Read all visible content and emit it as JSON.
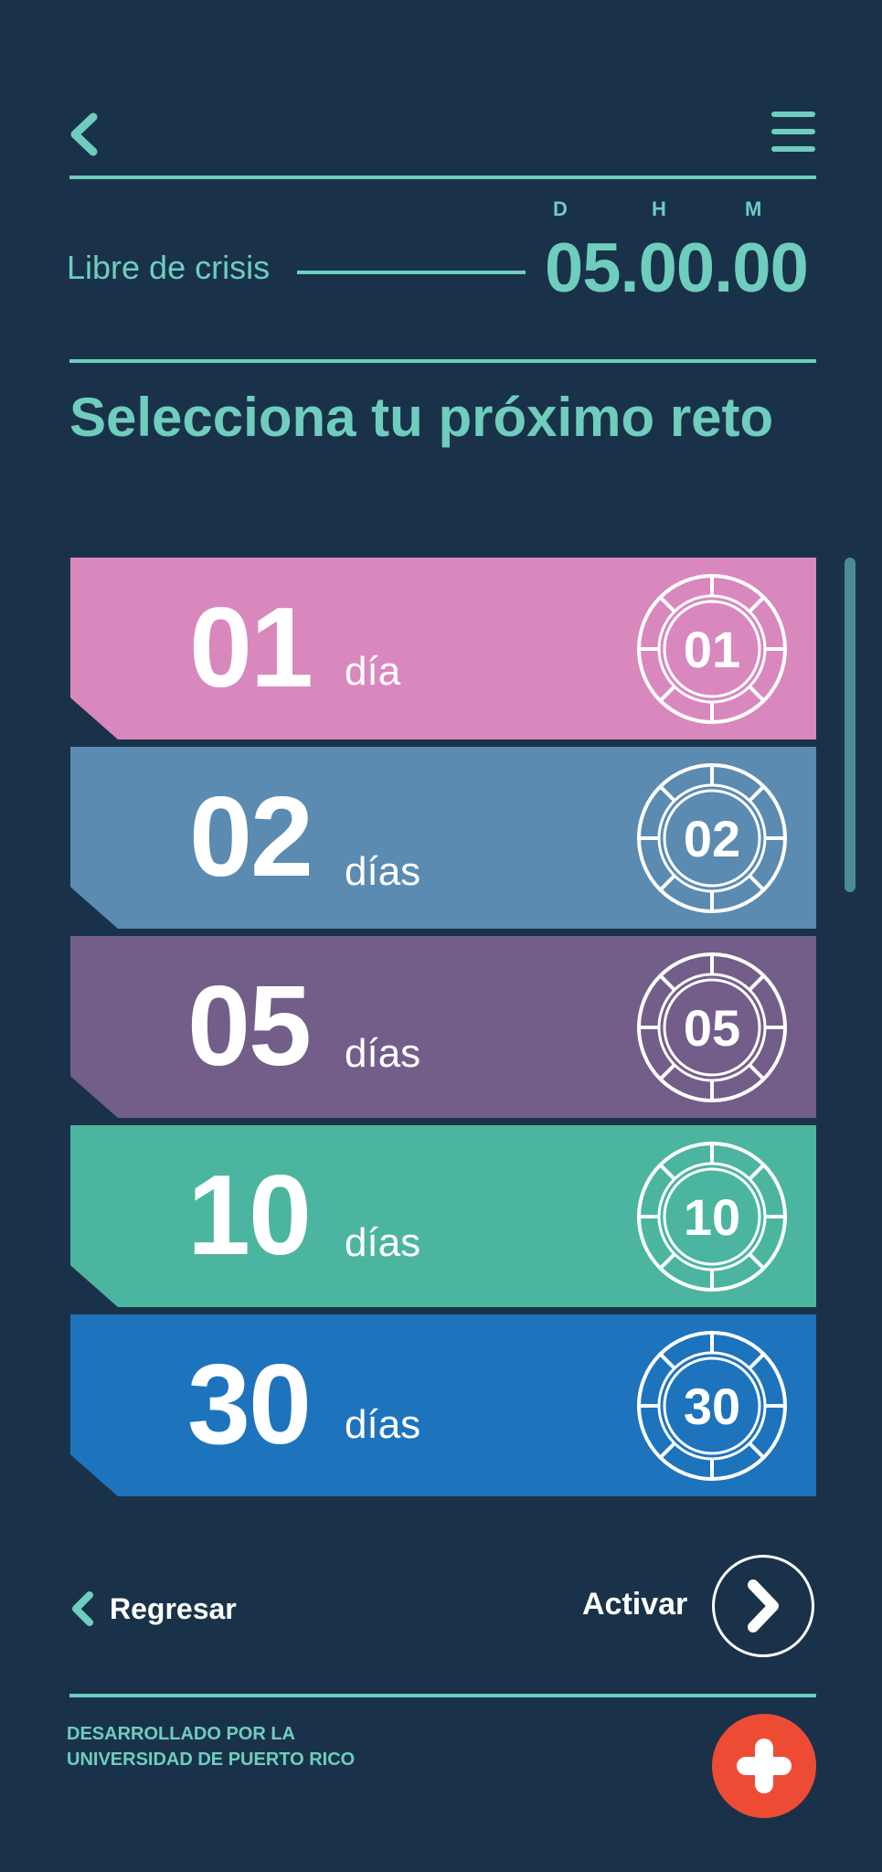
{
  "header": {
    "labels": {
      "d": "D",
      "h": "H",
      "m": "M"
    },
    "crisis_label": "Libre de crisis",
    "timer": "05.00.00"
  },
  "title": "Selecciona tu próximo reto",
  "challenges": [
    {
      "number": "01",
      "unit": "día",
      "badge": "01",
      "color": "#d988be"
    },
    {
      "number": "02",
      "unit": "días",
      "badge": "02",
      "color": "#5b8bb0"
    },
    {
      "number": "05",
      "unit": "días",
      "badge": "05",
      "color": "#725e89"
    },
    {
      "number": "10",
      "unit": "días",
      "badge": "10",
      "color": "#4cb5a0"
    },
    {
      "number": "30",
      "unit": "días",
      "badge": "30",
      "color": "#1e73bd"
    }
  ],
  "footer": {
    "back_label": "Regresar",
    "activate_label": "Activar",
    "credit_line1": "DESARROLLADO POR LA",
    "credit_line2": "UNIVERSIDAD DE PUERTO RICO"
  },
  "colors": {
    "background": "#19324a",
    "accent": "#6fcdbd",
    "emergency": "#ee4b35"
  },
  "icons": {
    "back": "chevron-left-icon",
    "menu": "hamburger-menu-icon",
    "badge": "medal-badge-icon",
    "next": "chevron-right-icon",
    "emergency": "plus-icon"
  }
}
